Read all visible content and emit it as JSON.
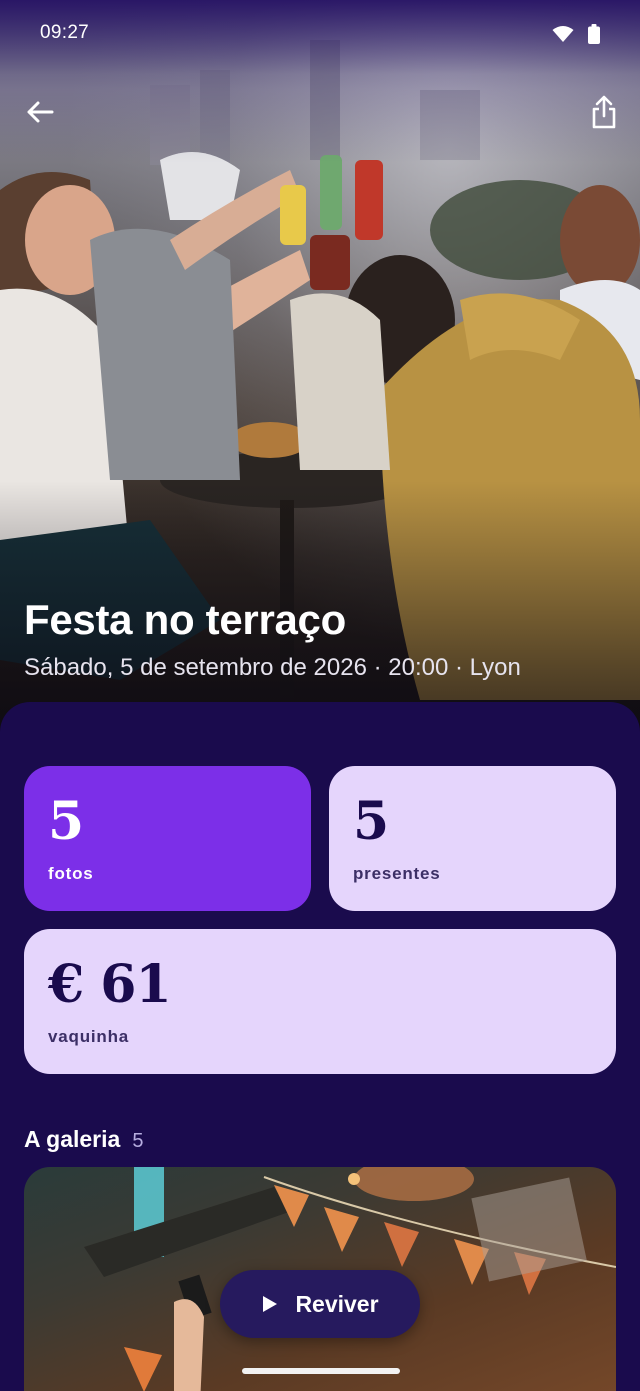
{
  "status_bar": {
    "time": "09:27",
    "wifi_icon": "wifi-icon",
    "battery_icon": "battery-icon"
  },
  "toolbar": {
    "back_icon": "arrow-left-icon",
    "share_icon": "share-icon"
  },
  "event": {
    "title": "Festa no terraço",
    "subtitle": "Sábado, 5 de setembro de 2026 · 20:00 · Lyon"
  },
  "stats": {
    "photos": {
      "value": "5",
      "label": "fotos"
    },
    "present": {
      "value": "5",
      "label": "presentes"
    },
    "fund": {
      "value": "€ 61",
      "label": "vaquinha"
    }
  },
  "gallery": {
    "title": "A galeria",
    "count": "5"
  },
  "relive_button": {
    "label": "Reviver",
    "icon": "play-icon"
  },
  "colors": {
    "sheet_bg": "#1a0b4d",
    "accent_purple": "#7c2fe8",
    "light_lilac": "#e5d5fc",
    "button_bg": "#261a5e"
  }
}
